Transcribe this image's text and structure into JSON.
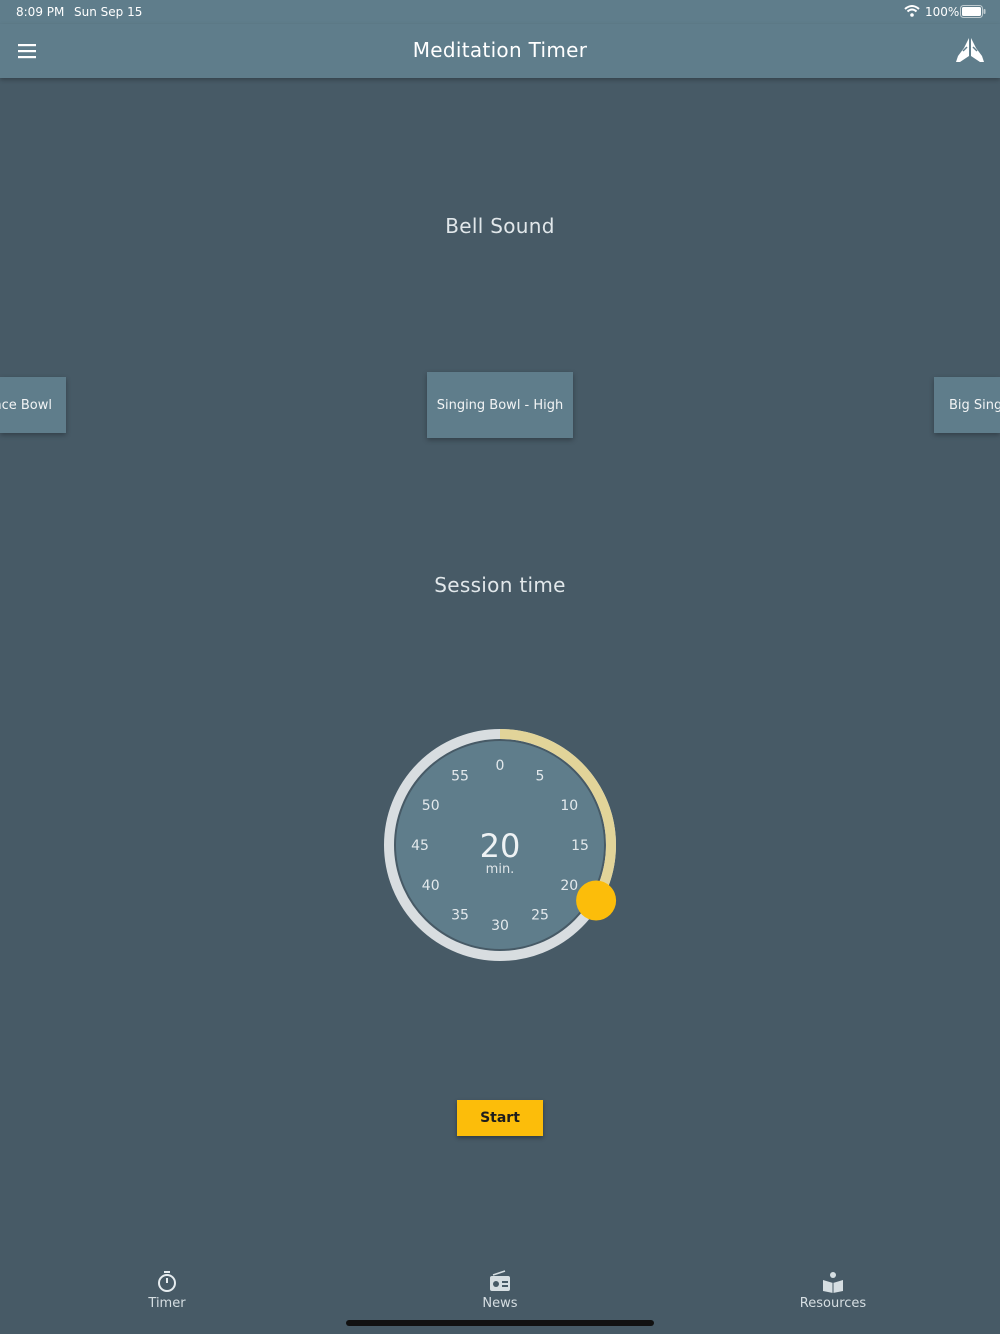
{
  "status_bar": {
    "time": "8:09 PM",
    "date": "Sun Sep 15",
    "battery": "100%"
  },
  "app_bar": {
    "title": "Meditation Timer",
    "menu_icon": "hamburger-menu-icon",
    "action_icon": "praying-hands-icon"
  },
  "bell": {
    "title": "Bell Sound",
    "options": [
      "nce Bowl",
      "Singing Bowl - High",
      "Big Sing"
    ],
    "selected": "Singing Bowl - High"
  },
  "session": {
    "title": "Session time",
    "value": "20",
    "unit": "min.",
    "ticks": [
      "0",
      "5",
      "10",
      "15",
      "20",
      "25",
      "30",
      "35",
      "40",
      "45",
      "50",
      "55"
    ],
    "max_minutes": 60,
    "selected_minutes": 20
  },
  "start_label": "Start",
  "nav": [
    {
      "label": "Timer",
      "icon": "stopwatch-icon"
    },
    {
      "label": "News",
      "icon": "radio-icon"
    },
    {
      "label": "Resources",
      "icon": "book-icon"
    }
  ],
  "colors": {
    "background": "#475a66",
    "app_bar": "#5f7d8b",
    "accent": "#fcbd0a",
    "dial_track": "#d8dde0",
    "dial_progress": "#e2d499"
  }
}
